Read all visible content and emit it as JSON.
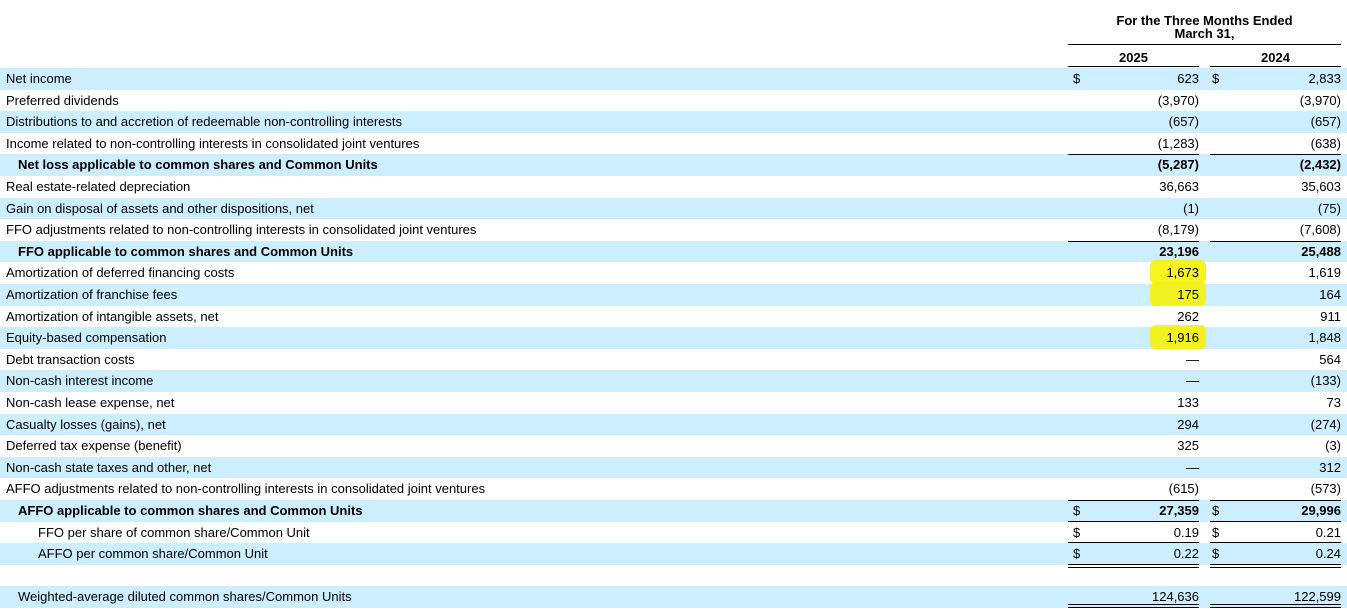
{
  "header": {
    "period_line1": "For the Three Months Ended",
    "period_line2": "March 31,",
    "year1": "2025",
    "year2": "2024"
  },
  "colors": {
    "shade": "#cceeff",
    "highlight": "#f5f20a"
  },
  "rows": [
    {
      "label": "Net income",
      "dol1": "$",
      "v1": "623",
      "dol2": "$",
      "v2": "2,833",
      "shade": true
    },
    {
      "label": "Preferred dividends",
      "v1": "(3,970)",
      "v2": "(3,970)",
      "shade": false
    },
    {
      "label": "Distributions to and accretion of redeemable non-controlling interests",
      "v1": "(657)",
      "v2": "(657)",
      "shade": true
    },
    {
      "label": "Income related to non-controlling interests in consolidated joint ventures",
      "v1": "(1,283)",
      "v2": "(638)",
      "shade": false
    },
    {
      "label": "Net loss applicable to common shares and Common Units",
      "v1": "(5,287)",
      "v2": "(2,432)",
      "shade": true,
      "bold": true
    },
    {
      "label": "Real estate-related depreciation",
      "v1": "36,663",
      "v2": "35,603",
      "shade": false
    },
    {
      "label": "Gain on disposal of assets and other dispositions, net",
      "v1": "(1)",
      "v2": "(75)",
      "shade": true
    },
    {
      "label": "FFO adjustments related to non-controlling interests in consolidated joint ventures",
      "v1": "(8,179)",
      "v2": "(7,608)",
      "shade": false
    },
    {
      "label": "FFO applicable to common shares and Common Units",
      "v1": "23,196",
      "v2": "25,488",
      "shade": true,
      "bold": true
    },
    {
      "label": "Amortization of deferred financing costs",
      "v1": "1,673",
      "v2": "1,619",
      "shade": false,
      "highlight": true
    },
    {
      "label": "Amortization of franchise fees",
      "v1": "175",
      "v2": "164",
      "shade": true,
      "highlight": true
    },
    {
      "label": "Amortization of intangible assets, net",
      "v1": "262",
      "v2": "911",
      "shade": false
    },
    {
      "label": "Equity-based compensation",
      "v1": "1,916",
      "v2": "1,848",
      "shade": true,
      "highlight": true
    },
    {
      "label": "Debt transaction costs",
      "v1": "—",
      "v2": "564",
      "shade": false
    },
    {
      "label": "Non-cash interest income",
      "v1": "—",
      "v2": "(133)",
      "shade": true
    },
    {
      "label": "Non-cash lease expense, net",
      "v1": "133",
      "v2": "73",
      "shade": false
    },
    {
      "label": "Casualty losses (gains), net",
      "v1": "294",
      "v2": "(274)",
      "shade": true
    },
    {
      "label": "Deferred tax expense (benefit)",
      "v1": "325",
      "v2": "(3)",
      "shade": false
    },
    {
      "label": "Non-cash state taxes and other, net",
      "v1": "—",
      "v2": "312",
      "shade": true
    },
    {
      "label": "AFFO adjustments related to non-controlling interests in consolidated joint ventures",
      "v1": "(615)",
      "v2": "(573)",
      "shade": false
    },
    {
      "label": "AFFO applicable to common shares and Common Units",
      "dol1": "$",
      "v1": "27,359",
      "dol2": "$",
      "v2": "29,996",
      "shade": true,
      "bold": true
    },
    {
      "label": "FFO per share of common share/Common Unit",
      "dol1": "$",
      "v1": "0.19",
      "dol2": "$",
      "v2": "0.21",
      "shade": false,
      "indent": 2
    },
    {
      "label": "AFFO per common share/Common Unit",
      "dol1": "$",
      "v1": "0.22",
      "dol2": "$",
      "v2": "0.24",
      "shade": true,
      "indent": 2
    }
  ],
  "weighted": {
    "label": "Weighted-average diluted common shares/Common Units",
    "v1": "124,636",
    "v2": "122,599"
  }
}
